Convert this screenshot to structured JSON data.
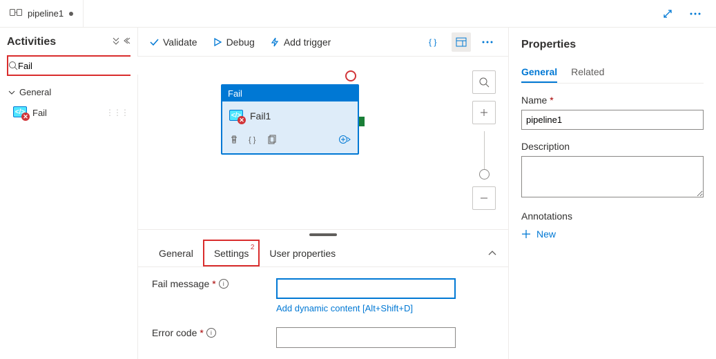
{
  "tab": {
    "icon_name": "pipeline-icon",
    "title": "pipeline1",
    "modified": true
  },
  "sidebar": {
    "title": "Activities",
    "search_value": "Fail",
    "category": {
      "label": "General",
      "expanded": true
    },
    "items": [
      {
        "label": "Fail",
        "icon": "fail-icon"
      }
    ]
  },
  "toolbar": {
    "validate": "Validate",
    "debug": "Debug",
    "add_trigger": "Add trigger"
  },
  "node": {
    "type": "Fail",
    "name": "Fail1"
  },
  "bottom": {
    "tabs": {
      "general": "General",
      "settings": "Settings",
      "settings_badge": "2",
      "user_props": "User properties"
    },
    "fail_message": {
      "label": "Fail message",
      "value": "",
      "dyn_link": "Add dynamic content [Alt+Shift+D]"
    },
    "error_code": {
      "label": "Error code",
      "value": ""
    }
  },
  "properties": {
    "title": "Properties",
    "tabs": {
      "general": "General",
      "related": "Related"
    },
    "name": {
      "label": "Name",
      "value": "pipeline1"
    },
    "description": {
      "label": "Description",
      "value": ""
    },
    "annotations": {
      "label": "Annotations",
      "new": "New"
    }
  }
}
